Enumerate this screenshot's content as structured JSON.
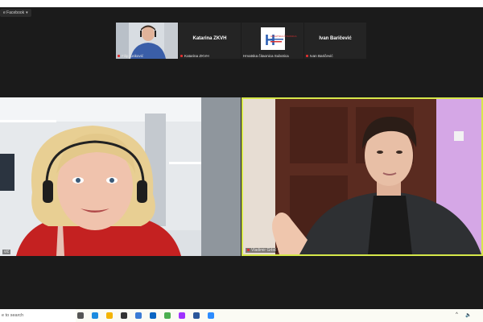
{
  "stream_badge": {
    "label": "e Facebook",
    "dropdown": "▾"
  },
  "participants_strip": [
    {
      "display_name": "",
      "label": "Filip Čeiković"
    },
    {
      "display_name": "Katarina ZKVH",
      "label": "Katarina ZKVH"
    },
    {
      "display_name": "",
      "label": "Hrvatska čitaonica Subotica",
      "logo_letter": "H",
      "logo_text": "HRVATSKA ČITAONICA"
    },
    {
      "display_name": "Ivan Baričević",
      "label": "Ivan Baričević"
    }
  ],
  "main_videos": [
    {
      "label": "vić"
    },
    {
      "label": "Vladimir Grbić"
    }
  ],
  "taskbar": {
    "search_placeholder": "e to search",
    "icons": [
      "task-view-icon",
      "edge-icon",
      "file-explorer-icon",
      "mail-icon",
      "store-icon",
      "linkedin-icon",
      "chrome-icon",
      "messenger-icon",
      "word-icon",
      "zoom-icon"
    ],
    "icon_colors": [
      "#555555",
      "#1d8ce0",
      "#f4b400",
      "#333333",
      "#3a7bd5",
      "#0a66c2",
      "#4caf50",
      "#a033ff",
      "#2b579a",
      "#2d8cff"
    ],
    "tray_chevron": "^",
    "tray_volume": "🔈"
  },
  "colors": {
    "background": "#1b1b1b",
    "active_speaker_border": "#d6e84a"
  }
}
